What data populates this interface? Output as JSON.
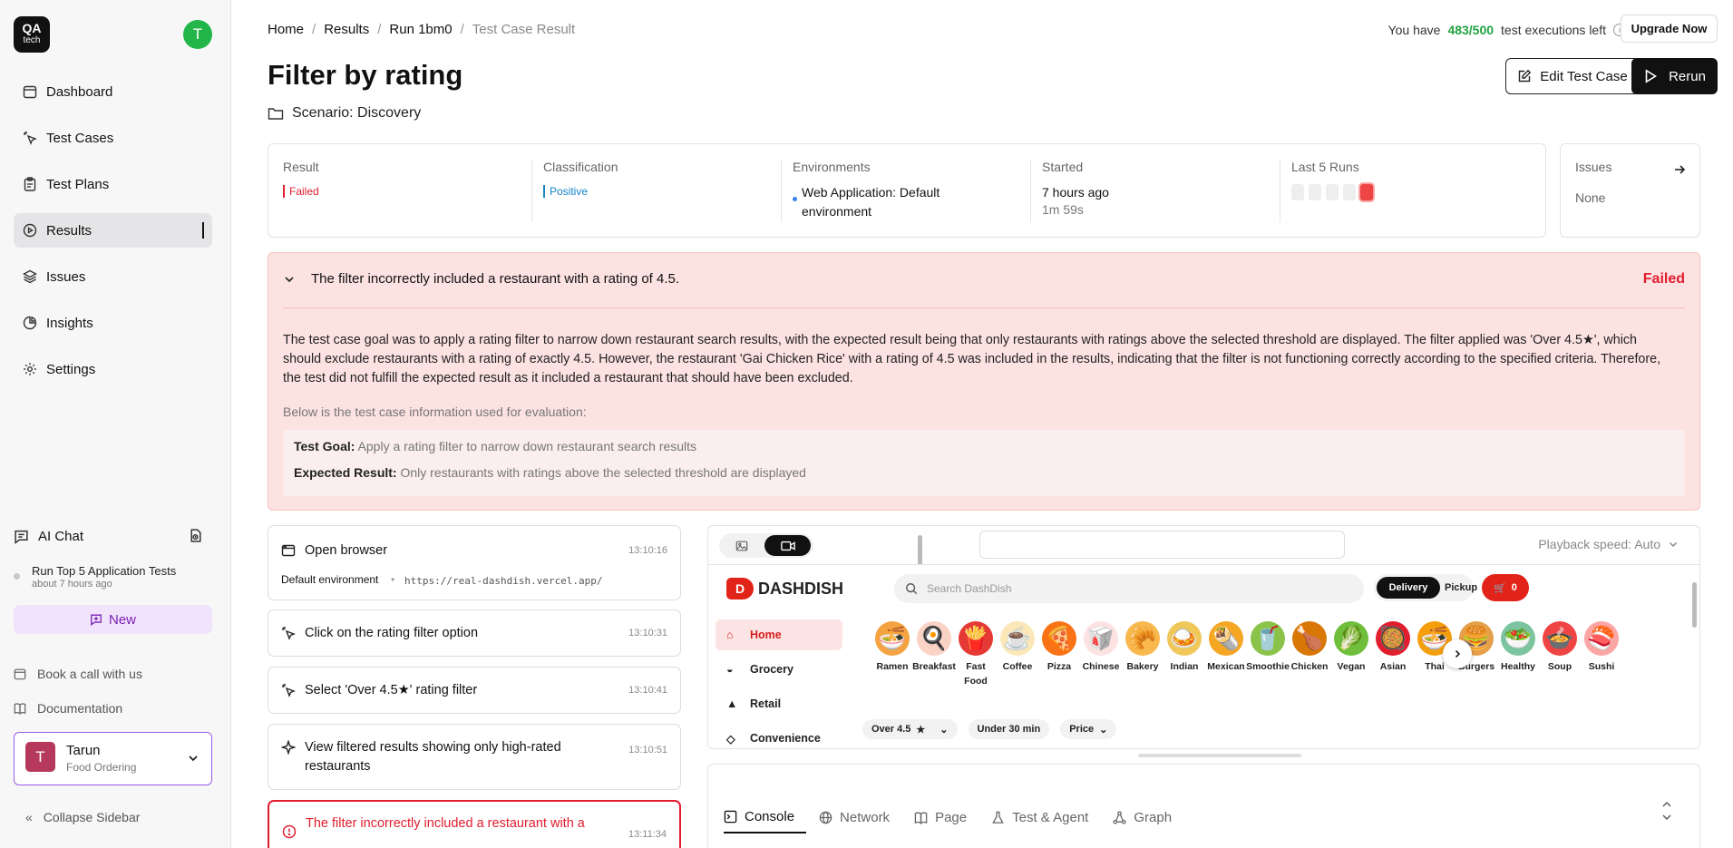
{
  "sidebar": {
    "logo_top": "QA",
    "logo_bottom": "tech",
    "user_initial": "T",
    "nav": [
      {
        "label": "Dashboard",
        "icon": "calendar-icon"
      },
      {
        "label": "Test Cases",
        "icon": "pointer-click-icon"
      },
      {
        "label": "Test Plans",
        "icon": "clipboard-icon"
      },
      {
        "label": "Results",
        "icon": "play-circle-icon",
        "active": true
      },
      {
        "label": "Issues",
        "icon": "layers-icon"
      },
      {
        "label": "Insights",
        "icon": "pie-chart-icon"
      },
      {
        "label": "Settings",
        "icon": "gear-icon"
      }
    ],
    "ai_chat_label": "AI Chat",
    "chat_title": "Run Top 5 Application Tests",
    "chat_time": "about 7 hours ago",
    "new_label": "New",
    "book_call": "Book a call with us",
    "documentation": "Documentation",
    "user_name": "Tarun",
    "user_org": "Food Ordering",
    "collapse_label": "Collapse Sidebar"
  },
  "header": {
    "breadcrumbs": [
      "Home",
      "Results",
      "Run 1bm0",
      "Test Case Result"
    ],
    "quota_prefix": "You have",
    "quota_value": "483/500",
    "quota_suffix": "test executions left",
    "upgrade_label": "Upgrade Now",
    "title": "Filter by rating",
    "scenario": "Scenario: Discovery",
    "edit_label": "Edit Test Case",
    "rerun_label": "Rerun"
  },
  "summary": {
    "result_label": "Result",
    "result_value": "Failed",
    "classification_label": "Classification",
    "classification_value": "Positive",
    "environments_label": "Environments",
    "environments_value": "Web Application: Default environment",
    "started_label": "Started",
    "started_value": "7 hours ago",
    "duration": "1m 59s",
    "last_runs_label": "Last 5 Runs",
    "last_runs": [
      "none",
      "none",
      "none",
      "none",
      "failed"
    ],
    "issues_label": "Issues",
    "issues_value": "None"
  },
  "failure": {
    "headline": "The filter incorrectly included a restaurant with a rating of 4.5.",
    "status": "Failed",
    "explanation": "The test case goal was to apply a rating filter to narrow down restaurant search results, with the expected result being that only restaurants with ratings above the selected threshold are displayed. The filter applied was 'Over 4.5★', which should exclude restaurants with a rating of exactly 4.5. However, the restaurant 'Gai Chicken Rice' with a rating of 4.5 was included in the results, indicating that the filter is not functioning correctly according to the specified criteria. Therefore, the test did not fulfill the expected result as it included a restaurant that should have been excluded.",
    "below_label": "Below is the test case information used for evaluation:",
    "goal_label": "Test Goal:",
    "goal_value": "Apply a rating filter to narrow down restaurant search results",
    "expected_label": "Expected Result:",
    "expected_value": "Only restaurants with ratings above the selected threshold are displayed"
  },
  "steps": [
    {
      "title": "Open browser",
      "time": "13:10:16",
      "sub_label": "Default environment",
      "url": "https://real-dashdish.vercel.app/",
      "icon": "browser-icon"
    },
    {
      "title": "Click on the rating filter option",
      "time": "13:10:31",
      "icon": "pointer-click-icon"
    },
    {
      "title": "Select 'Over 4.5★' rating filter",
      "time": "13:10:41",
      "icon": "pointer-click-icon"
    },
    {
      "title": "View filtered results showing only high-rated restaurants",
      "time": "13:10:51",
      "icon": "sparkle-icon"
    },
    {
      "title": "The filter incorrectly included a restaurant with a",
      "time": "13:11:34",
      "icon": "alert-circle-icon",
      "error": true
    }
  ],
  "viewer": {
    "playback_label": "Playback speed: Auto",
    "app_name": "DASHDISH",
    "search_placeholder": "Search DashDish",
    "delivery": "Delivery",
    "pickup": "Pickup",
    "cart_count": "0",
    "nav": [
      "Home",
      "Grocery",
      "Retail",
      "Convenience"
    ],
    "categories": [
      {
        "label": "Ramen",
        "emoji": "🍜"
      },
      {
        "label": "Breakfast",
        "emoji": "🍳"
      },
      {
        "label": "Fast Food",
        "emoji": "🍟"
      },
      {
        "label": "Coffee",
        "emoji": "☕"
      },
      {
        "label": "Pizza",
        "emoji": "🍕"
      },
      {
        "label": "Chinese",
        "emoji": "🥡"
      },
      {
        "label": "Bakery",
        "emoji": "🥐"
      },
      {
        "label": "Indian",
        "emoji": "🍛"
      },
      {
        "label": "Mexican",
        "emoji": "🌯"
      },
      {
        "label": "Smoothie",
        "emoji": "🥤"
      },
      {
        "label": "Chicken",
        "emoji": "🍗"
      },
      {
        "label": "Vegan",
        "emoji": "🥬"
      },
      {
        "label": "Asian",
        "emoji": "🥘"
      },
      {
        "label": "Thai",
        "emoji": "🍜"
      },
      {
        "label": "Burgers",
        "emoji": "🍔"
      },
      {
        "label": "Healthy",
        "emoji": "🥗"
      },
      {
        "label": "Soup",
        "emoji": "🍲"
      },
      {
        "label": "Sushi",
        "emoji": "🍣"
      }
    ],
    "filters": [
      "Over 4.5",
      "Under 30 min",
      "Price"
    ]
  },
  "console": {
    "tabs": [
      "Console",
      "Network",
      "Page",
      "Test & Agent",
      "Graph"
    ]
  },
  "colors": {
    "accent_green": "#22a33f",
    "fail_red": "#e11d2e",
    "positive_blue": "#1683c8",
    "new_purple": "#7b22b4"
  }
}
